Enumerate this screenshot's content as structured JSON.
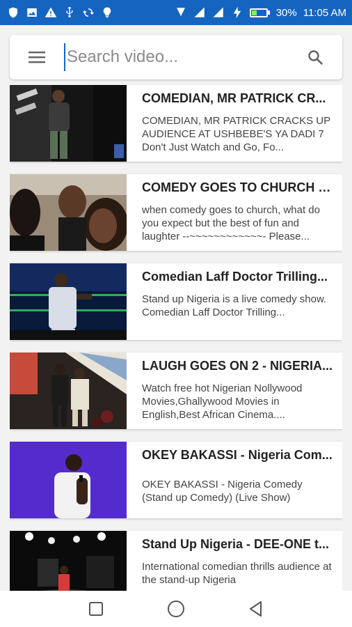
{
  "status_bar": {
    "battery_percent": "30%",
    "battery_level": 0.3,
    "time": "11:05 AM",
    "left_icons": [
      "shield-icon",
      "image-icon",
      "warning-icon",
      "usb-icon",
      "sync-icon",
      "bulb-icon"
    ],
    "right_icons": [
      "vibrate-icon",
      "wifi-icon",
      "signal-icon",
      "signal-icon",
      "charging-icon"
    ]
  },
  "search": {
    "placeholder": "Search video...",
    "value": "",
    "menu_icon": "menu-icon",
    "search_icon": "search-icon",
    "accent": "#1565c0"
  },
  "videos": [
    {
      "title": "COMEDIAN, MR PATRICK CR...",
      "description": "COMEDIAN, MR PATRICK CRACKS UP AUDIENCE AT USHBEBE'S YA DADI 7 Don't Just Watch and Go, Fo..."
    },
    {
      "title": "COMEDY GOES TO CHURCH 2...",
      "description": "when comedy goes to church, what do you expect but the best of fun and laughter --~~~~~~~~~~~~- Please..."
    },
    {
      "title": "Comedian Laff Doctor Trilling...",
      "description": "Stand up Nigeria is a live comedy show.\nComedian Laff Doctor Trilling..."
    },
    {
      "title": "LAUGH GOES ON 2 - NIGERIA...",
      "description": "Watch free hot Nigerian Nollywood Movies,Ghallywood Movies in English,Best African Cinema...."
    },
    {
      "title": "OKEY BAKASSI - Nigeria Com...",
      "description": "OKEY BAKASSI - Nigeria Comedy (Stand up Comedy) (Live Show)"
    },
    {
      "title": "Stand Up Nigeria - DEE-ONE t...",
      "description": "International comedian thrills audience at the stand-up Nigeria"
    }
  ],
  "nav": {
    "icons": [
      "recent-apps-icon",
      "home-icon",
      "back-icon"
    ]
  }
}
